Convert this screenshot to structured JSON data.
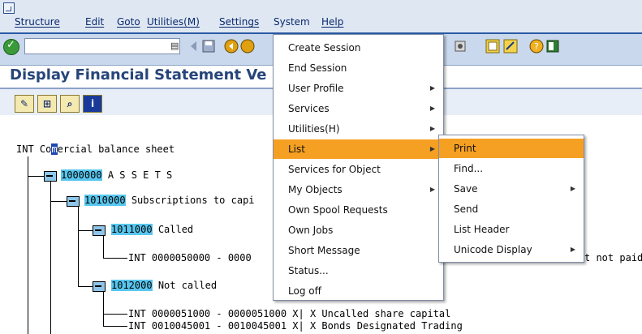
{
  "menubar": {
    "items": [
      "Structure",
      "Edit",
      "Goto",
      "Utilities(M)",
      "Settings",
      "System",
      "Help"
    ]
  },
  "toolbar": {
    "icons": [
      "enter-icon",
      "back-icon",
      "save-icon",
      "exit-icon",
      "cancel-icon",
      "find-icon",
      "layout-icon",
      "help-icon",
      "customize-icon"
    ]
  },
  "screen": {
    "title": "Display Financial Statement Ve"
  },
  "tree": {
    "root": {
      "prefix": "INT",
      "cursor_char": "m",
      "label_before": "Co",
      "label_after": "ercial balance sheet"
    },
    "n1": {
      "code": "1000000",
      "text": "A S S E T S"
    },
    "n2": {
      "code": "1010000",
      "text": "Subscriptions to capi"
    },
    "n3": {
      "code": "1011000",
      "text": "Called"
    },
    "n3a": {
      "text": "INT 0000050000 - 0000"
    },
    "n3a_tail": {
      "text": "t not paid"
    },
    "n4": {
      "code": "1012000",
      "text": "Not called"
    },
    "n4a": {
      "text": "INT 0000051000 - 0000051000 X| X Uncalled share capital"
    },
    "n4b": {
      "text": "INT 0010045001 - 0010045001 X| X Bonds Designated Trading"
    }
  },
  "system_menu": {
    "items": [
      {
        "label": "Create Session",
        "submenu": false
      },
      {
        "label": "End Session",
        "submenu": false
      },
      {
        "label": "User Profile",
        "submenu": true
      },
      {
        "label": "Services",
        "submenu": true
      },
      {
        "label": "Utilities(H)",
        "submenu": true
      },
      {
        "label": "List",
        "submenu": true,
        "highlight": true
      },
      {
        "label": "Services for Object",
        "submenu": false
      },
      {
        "label": "My Objects",
        "submenu": true
      },
      {
        "label": "Own Spool Requests",
        "submenu": false
      },
      {
        "label": "Own Jobs",
        "submenu": false
      },
      {
        "label": "Short Message",
        "submenu": false
      },
      {
        "label": "Status...",
        "submenu": false
      },
      {
        "label": "Log off",
        "submenu": false
      }
    ]
  },
  "list_menu": {
    "items": [
      {
        "label": "Print",
        "submenu": false,
        "highlight": true
      },
      {
        "label": "Find...",
        "submenu": false
      },
      {
        "label": "Save",
        "submenu": true
      },
      {
        "label": "Send",
        "submenu": false
      },
      {
        "label": "List Header",
        "submenu": false
      },
      {
        "label": "Unicode Display",
        "submenu": true
      }
    ]
  },
  "colors": {
    "highlight": "#f6a023",
    "node": "#58c6ee",
    "title": "#26457a"
  }
}
